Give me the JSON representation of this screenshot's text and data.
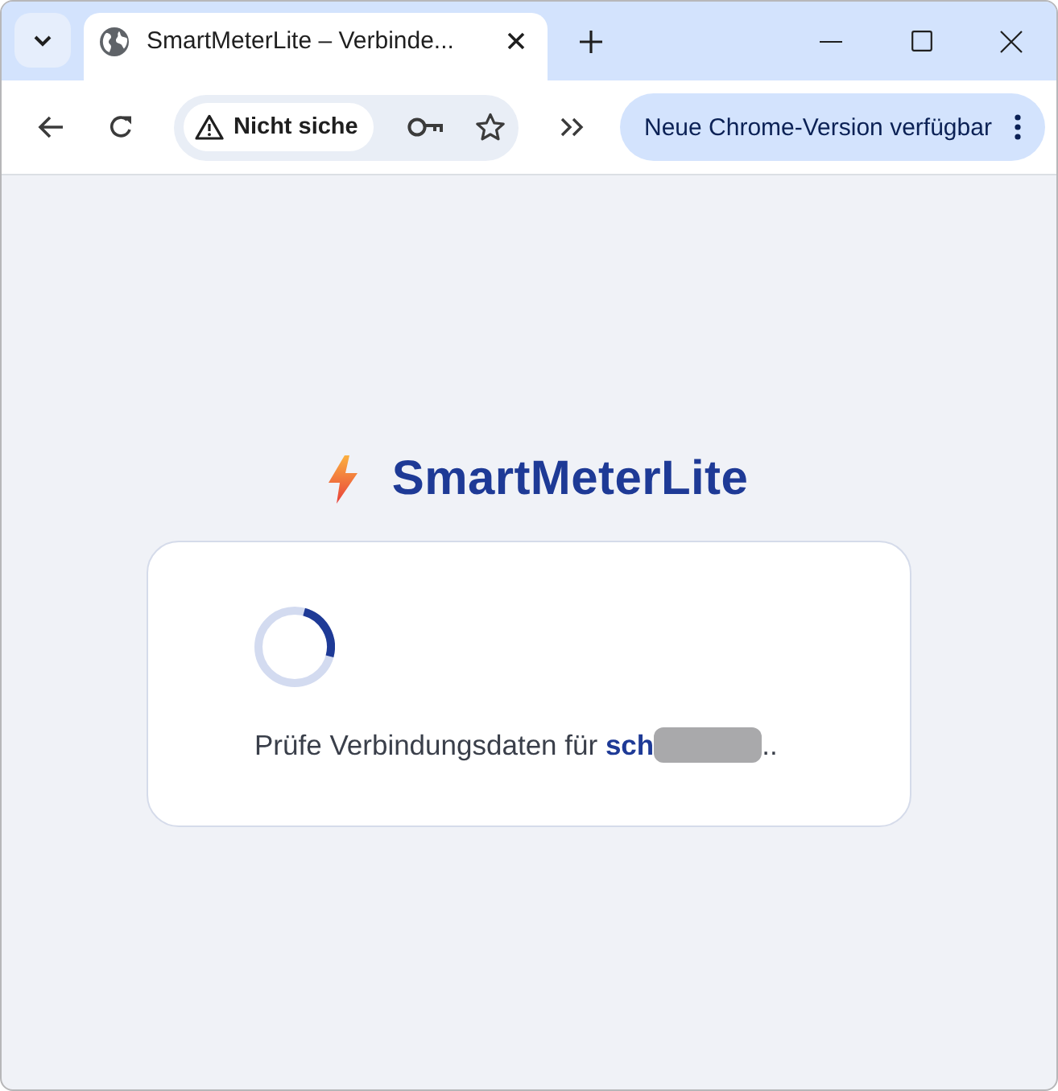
{
  "browser": {
    "tab_title": "SmartMeterLite – Verbinde...",
    "security_chip": "Nicht siche",
    "update_button": "Neue Chrome-Version verfügbar"
  },
  "app": {
    "logo": "SmartMeterLite",
    "status": {
      "loading": true,
      "message": "Prüfe Verbindungsdaten für **sch**",
      "redacted": true,
      "suffix": ".."
    }
  }
}
